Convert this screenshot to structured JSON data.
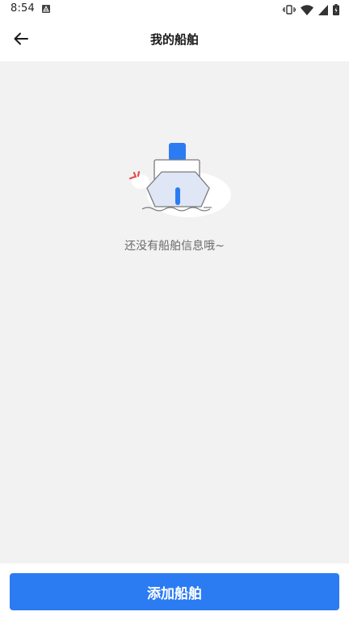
{
  "status_bar": {
    "time": "8:54",
    "icons": [
      "app-notification-icon",
      "vibrate-icon",
      "wifi-icon",
      "cell-signal-icon",
      "battery-charging-icon"
    ]
  },
  "app_bar": {
    "title": "我的船舶",
    "back_icon": "arrow-left-icon"
  },
  "empty_state": {
    "icon": "ship-illustration-icon",
    "message": "还没有船舶信息哦~"
  },
  "actions": {
    "add_label": "添加船舶"
  },
  "colors": {
    "primary": "#2b7bf3",
    "content_bg": "#f2f2f2",
    "accent_red": "#e05050"
  }
}
